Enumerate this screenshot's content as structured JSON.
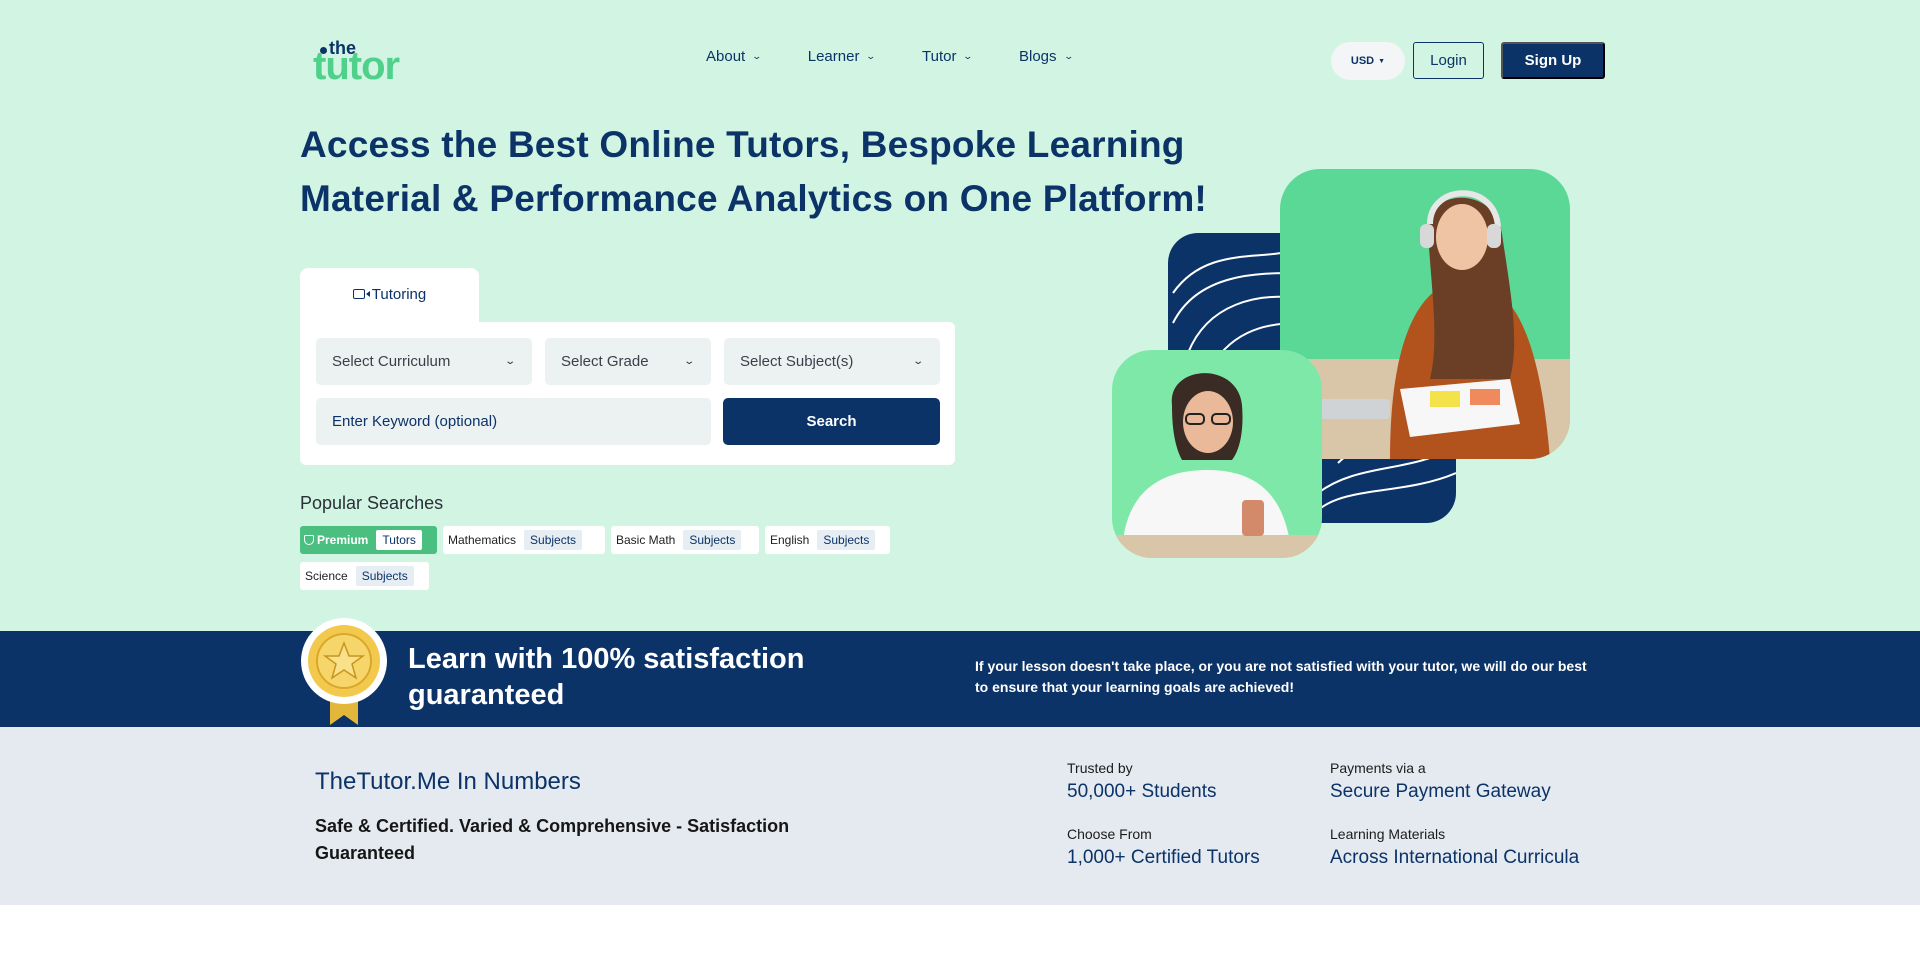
{
  "brand": {
    "logo_top": "the",
    "logo_main": "tutor"
  },
  "nav": {
    "items": [
      "About",
      "Learner",
      "Tutor",
      "Blogs"
    ]
  },
  "header": {
    "currency": "USD",
    "login_label": "Login",
    "signup_label": "Sign Up"
  },
  "hero": {
    "headline": "Access the Best Online Tutors, Bespoke Learning Material & Performance Analytics on One Platform!"
  },
  "search": {
    "tab_label": "Tutoring",
    "curriculum_placeholder": "Select Curriculum",
    "grade_placeholder": "Select Grade",
    "subject_placeholder": "Select Subject(s)",
    "keyword_placeholder": "Enter Keyword (optional)",
    "search_label": "Search"
  },
  "popular": {
    "title": "Popular Searches",
    "chips": [
      {
        "name": "Premium",
        "tag": "Tutors"
      },
      {
        "name": "Mathematics",
        "tag": "Subjects"
      },
      {
        "name": "Basic Math",
        "tag": "Subjects"
      },
      {
        "name": "English",
        "tag": "Subjects"
      },
      {
        "name": "Science",
        "tag": "Subjects"
      }
    ]
  },
  "banner": {
    "title": "Learn with 100% satisfaction guaranteed",
    "text": "If your lesson doesn't take place, or you are not satisfied with your tutor, we will do our best to ensure that your learning goals are achieved!"
  },
  "numbers": {
    "title": "TheTutor.Me In Numbers",
    "subtitle": "Safe & Certified. Varied & Comprehensive - Satisfaction Guaranteed",
    "stats": [
      {
        "label": "Trusted by",
        "value": "50,000+ Students"
      },
      {
        "label": "Payments via a",
        "value": "Secure Payment Gateway"
      },
      {
        "label": "Choose From",
        "value": "1,000+ Certified Tutors"
      },
      {
        "label": "Learning Materials",
        "value": "Across International Curricula"
      }
    ]
  },
  "colors": {
    "navy": "#0b3368",
    "mint_bg": "#d1f5e2",
    "green": "#4fd08b",
    "light_gray": "#e4eaf0"
  }
}
